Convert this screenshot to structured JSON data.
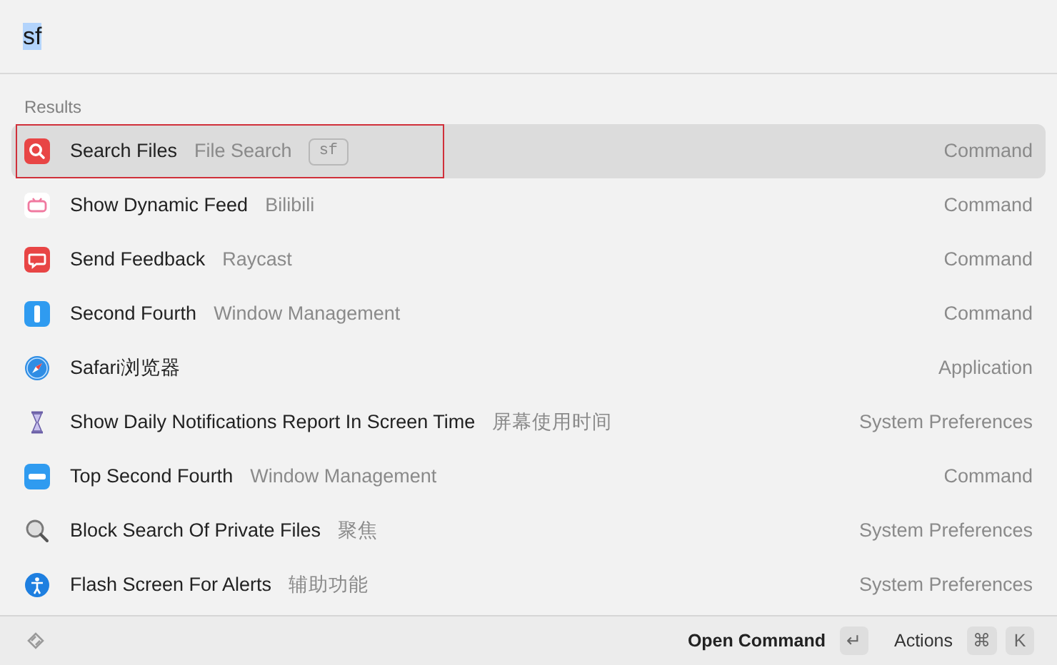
{
  "search": {
    "value": "sf",
    "text_selected": true
  },
  "section_title": "Results",
  "results": [
    {
      "title": "Search Files",
      "subtitle": "File Search",
      "keyword": "sf",
      "type": "Command",
      "selected": true
    },
    {
      "title": "Show Dynamic Feed",
      "subtitle": "Bilibili",
      "type": "Command",
      "selected": false
    },
    {
      "title": "Send Feedback",
      "subtitle": "Raycast",
      "type": "Command",
      "selected": false
    },
    {
      "title": "Second Fourth",
      "subtitle": "Window Management",
      "type": "Command",
      "selected": false
    },
    {
      "title": "Safari浏览器",
      "type": "Application",
      "selected": false
    },
    {
      "title": "Show Daily Notifications Report In Screen Time",
      "subtitle": "屏幕使用时间",
      "type": "System Preferences",
      "selected": false
    },
    {
      "title": "Top Second Fourth",
      "subtitle": "Window Management",
      "type": "Command",
      "selected": false
    },
    {
      "title": "Block Search Of Private Files",
      "subtitle": "聚焦",
      "type": "System Preferences",
      "selected": false
    },
    {
      "title": "Flash Screen For Alerts",
      "subtitle": "辅助功能",
      "type": "System Preferences",
      "selected": false
    }
  ],
  "footer": {
    "primary_action": "Open Command",
    "primary_key": "↵",
    "actions_label": "Actions",
    "actions_keys": [
      "⌘",
      "K"
    ]
  }
}
